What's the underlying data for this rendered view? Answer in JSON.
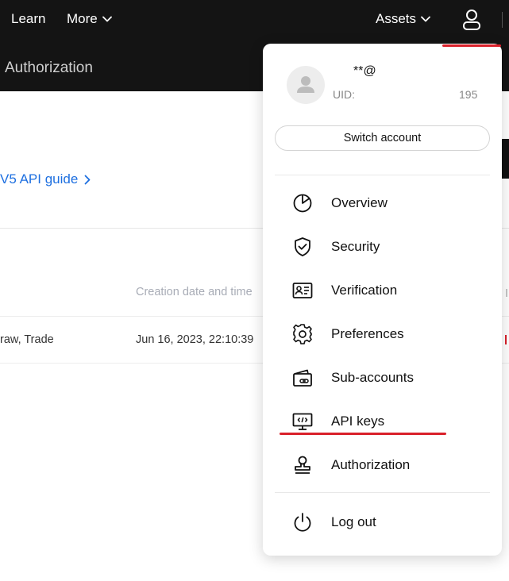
{
  "nav": {
    "learn": "Learn",
    "more": "More",
    "assets": "Assets"
  },
  "page": {
    "subheader_title": "Authorization",
    "api_guide_link": "V5 API guide",
    "column_header_created": "Creation date and time",
    "row_permissions": "raw, Trade",
    "row_created": "Jun 16, 2023, 22:10:39"
  },
  "account": {
    "email": "**@",
    "uid_label": "UID:",
    "uid_value": "195",
    "switch_account": "Switch account"
  },
  "menu": {
    "items": [
      {
        "label": "Overview",
        "icon": "pie-chart-icon"
      },
      {
        "label": "Security",
        "icon": "shield-check-icon"
      },
      {
        "label": "Verification",
        "icon": "id-card-icon"
      },
      {
        "label": "Preferences",
        "icon": "gear-icon"
      },
      {
        "label": "Sub-accounts",
        "icon": "sub-account-wallet-icon"
      },
      {
        "label": "API keys",
        "icon": "api-monitor-icon"
      },
      {
        "label": "Authorization",
        "icon": "stamp-icon"
      }
    ],
    "logout": "Log out"
  },
  "colors": {
    "nav_bg": "#141414",
    "link_blue": "#1d6fe0",
    "highlight_red": "#d9202a"
  }
}
